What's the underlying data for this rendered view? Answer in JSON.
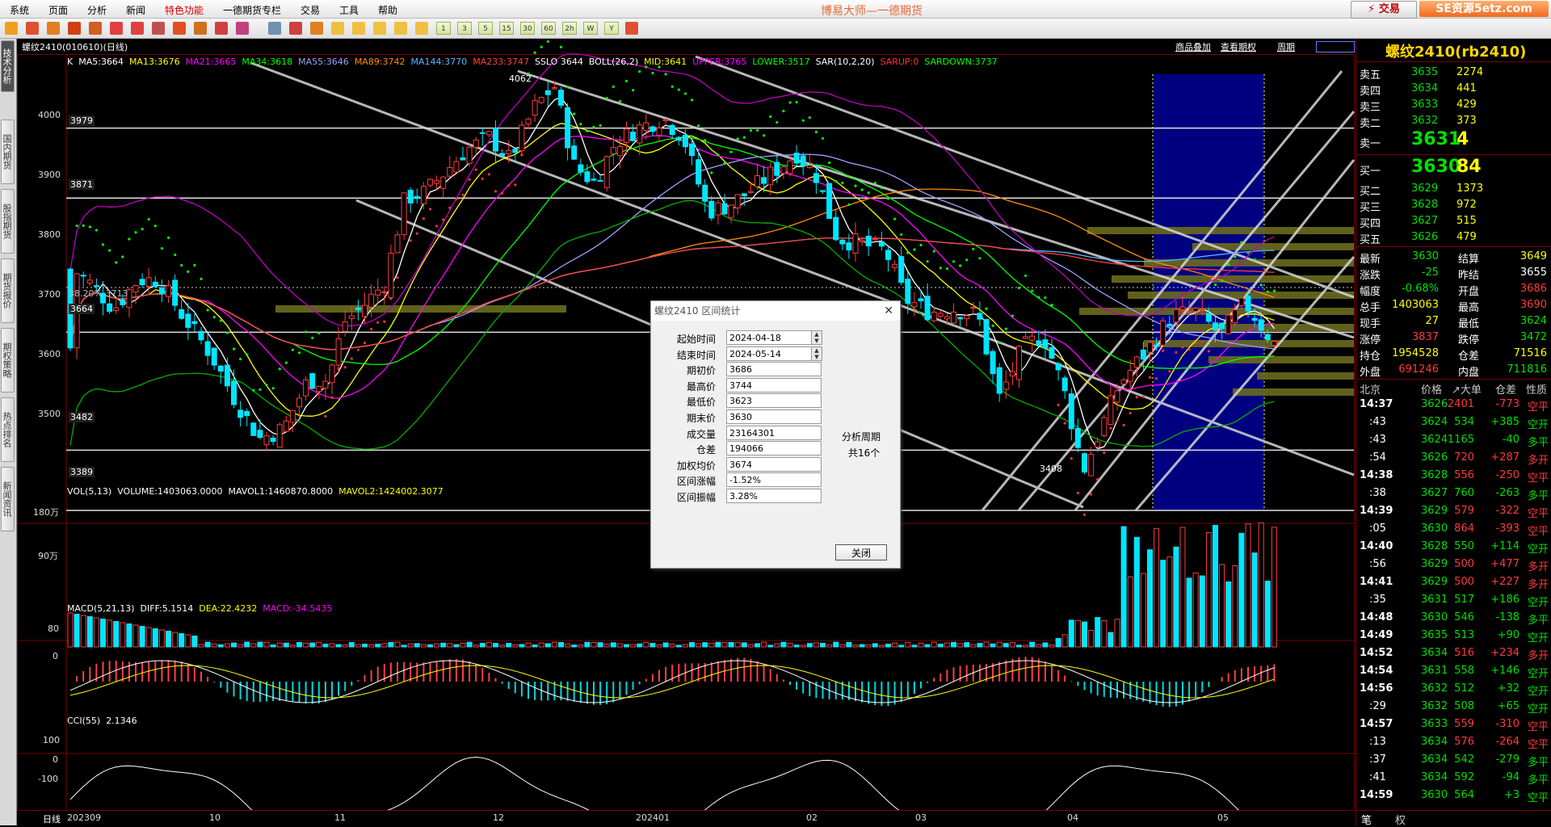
{
  "app_title": "博易大师—一德期货",
  "menu": [
    "系统",
    "页面",
    "分析",
    "新闻",
    "特色功能",
    "一德期货专栏",
    "交易",
    "工具",
    "帮助"
  ],
  "buttons": {
    "trade": "交易",
    "notice": "SE资源5etz.com"
  },
  "toolbar_periods": [
    "1",
    "3",
    "5",
    "15",
    "30",
    "60",
    "2h",
    "W",
    "Y"
  ],
  "sidebar_tabs": [
    "技术分析",
    "国内期货",
    "股指期货",
    "期货报价",
    "期权策略",
    "热点排名",
    "新闻资讯"
  ],
  "chart": {
    "symbol_label": "螺纹2410(010610)(日线)",
    "top_links": [
      "商品叠加",
      "查看期权",
      "周期"
    ],
    "indicator_line": [
      {
        "t": "K",
        "c": "#ffffff"
      },
      {
        "t": "MA5:3664",
        "c": "#ffffff"
      },
      {
        "t": "MA13:3676",
        "c": "#ffff00"
      },
      {
        "t": "MA21:3665",
        "c": "#ff00ff"
      },
      {
        "t": "MA34:3618",
        "c": "#00ff00"
      },
      {
        "t": "MA55:3646",
        "c": "#9fa0ff"
      },
      {
        "t": "MA89:3742",
        "c": "#ff8c00"
      },
      {
        "t": "MA144:3770",
        "c": "#5ab4ff"
      },
      {
        "t": "MA233:3747",
        "c": "#ff4040"
      },
      {
        "t": "SSLO 3644",
        "c": "#ffffff"
      },
      {
        "t": "BOLL(26,2)",
        "c": "#ffffff"
      },
      {
        "t": "MID:3641",
        "c": "#ffff00"
      },
      {
        "t": "UPPER:3765",
        "c": "#ff00ff"
      },
      {
        "t": "LOWER:3517",
        "c": "#00ff00"
      },
      {
        "t": "SAR(10,2,20)",
        "c": "#ffffff"
      },
      {
        "t": "SARUP:0",
        "c": "#ff3030"
      },
      {
        "t": "SARDOWN:3737",
        "c": "#00ff00"
      }
    ],
    "price_levels": [
      "4000",
      "3900",
      "3800",
      "3700",
      "3600",
      "3500"
    ],
    "hline_labels": [
      "3979",
      "3871",
      "3664",
      "3482",
      "3389"
    ],
    "fib_label": "38.20%",
    "fib_value": "3713",
    "high_marker": "4062",
    "low_marker": "3408",
    "vol_header": [
      {
        "t": "VOL(5,13)",
        "c": "#ffffff"
      },
      {
        "t": "VOLUME:1403063.0000",
        "c": "#ffffff"
      },
      {
        "t": "MAVOL1:1460870.8000",
        "c": "#ffffff"
      },
      {
        "t": "MAVOL2:1424002.3077",
        "c": "#ffff00"
      }
    ],
    "vol_levels": [
      "180万",
      "90万"
    ],
    "macd_header": [
      {
        "t": "MACD(5,21,13)",
        "c": "#ffffff"
      },
      {
        "t": "DIFF:5.1514",
        "c": "#ffffff"
      },
      {
        "t": "DEA:22.4232",
        "c": "#ffff00"
      },
      {
        "t": "MACD:-34.5435",
        "c": "#ff00ff"
      }
    ],
    "macd_levels": [
      "80",
      "0"
    ],
    "cci_header": [
      {
        "t": "CCI(55)",
        "c": "#ffffff"
      },
      {
        "t": "2.1346",
        "c": "#ffffff"
      }
    ],
    "cci_levels": [
      "100",
      "0",
      "-100"
    ],
    "x_labels": [
      "202309",
      "10",
      "11",
      "12",
      "202401",
      "02",
      "03",
      "04",
      "05"
    ],
    "period_tab": "日线"
  },
  "dialog": {
    "title": "螺纹2410 区间统计",
    "fields": [
      {
        "label": "起始时间",
        "value": "2024-04-18"
      },
      {
        "label": "结束时间",
        "value": "2024-05-14"
      },
      {
        "label": "期初价",
        "value": "3686"
      },
      {
        "label": "最高价",
        "value": "3744"
      },
      {
        "label": "最低价",
        "value": "3623"
      },
      {
        "label": "期末价",
        "value": "3630"
      },
      {
        "label": "成交量",
        "value": "23164301"
      },
      {
        "label": "仓差",
        "value": "194066"
      },
      {
        "label": "加权均价",
        "value": "3674"
      },
      {
        "label": "区间涨幅",
        "value": "-1.52%"
      },
      {
        "label": "区间振幅",
        "value": "3.28%"
      }
    ],
    "period_label": "分析周期",
    "period_count": "共16个",
    "close": "关闭"
  },
  "quote": {
    "title": "螺纹2410(rb2410)",
    "asks": [
      {
        "n": "卖五",
        "p": "3635",
        "v": "2274"
      },
      {
        "n": "卖四",
        "p": "3634",
        "v": "441"
      },
      {
        "n": "卖三",
        "p": "3633",
        "v": "429"
      },
      {
        "n": "卖二",
        "p": "3632",
        "v": "373"
      },
      {
        "n": "卖一",
        "p": "3631",
        "v": "4"
      }
    ],
    "bids": [
      {
        "n": "买一",
        "p": "3630",
        "v": "84"
      },
      {
        "n": "买二",
        "p": "3629",
        "v": "1373"
      },
      {
        "n": "买三",
        "p": "3628",
        "v": "972"
      },
      {
        "n": "买四",
        "p": "3627",
        "v": "515"
      },
      {
        "n": "买五",
        "p": "3626",
        "v": "479"
      }
    ],
    "stats": [
      {
        "l1": "最新",
        "v1": "3630",
        "c1": "grn",
        "l2": "结算",
        "v2": "3649",
        "c2": "yel"
      },
      {
        "l1": "涨跌",
        "v1": "-25",
        "c1": "grn",
        "l2": "昨结",
        "v2": "3655",
        "c2": "wht"
      },
      {
        "l1": "幅度",
        "v1": "-0.68%",
        "c1": "grn",
        "l2": "开盘",
        "v2": "3686",
        "c2": "red"
      },
      {
        "l1": "总手",
        "v1": "1403063",
        "c1": "yel",
        "l2": "最高",
        "v2": "3690",
        "c2": "red"
      },
      {
        "l1": "现手",
        "v1": "27",
        "c1": "yel",
        "l2": "最低",
        "v2": "3624",
        "c2": "grn"
      },
      {
        "l1": "涨停",
        "v1": "3837",
        "c1": "red",
        "l2": "跌停",
        "v2": "3472",
        "c2": "grn"
      },
      {
        "l1": "持仓",
        "v1": "1954528",
        "c1": "yel",
        "l2": "仓差",
        "v2": "71516",
        "c2": "yel"
      },
      {
        "l1": "外盘",
        "v1": "691246",
        "c1": "red",
        "l2": "内盘",
        "v2": "711816",
        "c2": "grn"
      }
    ],
    "tick_header": {
      "place": "北京",
      "price": "价格",
      "vol": "↗大单",
      "diff": "仓差",
      "nature": "性质"
    },
    "ticks": [
      {
        "t": "14:37",
        "p": "3626",
        "v": "2401",
        "d": "-773",
        "n": "空平",
        "pc": "grn",
        "vc": "red",
        "nc": "red"
      },
      {
        "t": ":43",
        "p": "3624",
        "v": "534",
        "d": "+385",
        "n": "空开",
        "pc": "grn",
        "vc": "grn",
        "nc": "grn"
      },
      {
        "t": ":43",
        "p": "3624",
        "v": "1165",
        "d": "-40",
        "n": "多平",
        "pc": "grn",
        "vc": "grn",
        "nc": "grn"
      },
      {
        "t": ":54",
        "p": "3626",
        "v": "720",
        "d": "+287",
        "n": "多开",
        "pc": "grn",
        "vc": "red",
        "nc": "red"
      },
      {
        "t": "14:38",
        "p": "3628",
        "v": "556",
        "d": "-250",
        "n": "空平",
        "pc": "grn",
        "vc": "red",
        "nc": "red"
      },
      {
        "t": ":38",
        "p": "3627",
        "v": "760",
        "d": "-263",
        "n": "多平",
        "pc": "grn",
        "vc": "grn",
        "nc": "grn"
      },
      {
        "t": "14:39",
        "p": "3629",
        "v": "579",
        "d": "-322",
        "n": "空平",
        "pc": "grn",
        "vc": "red",
        "nc": "red"
      },
      {
        "t": ":05",
        "p": "3630",
        "v": "864",
        "d": "-393",
        "n": "空平",
        "pc": "grn",
        "vc": "red",
        "nc": "red"
      },
      {
        "t": "14:40",
        "p": "3628",
        "v": "550",
        "d": "+114",
        "n": "空开",
        "pc": "grn",
        "vc": "grn",
        "nc": "grn"
      },
      {
        "t": ":56",
        "p": "3629",
        "v": "500",
        "d": "+477",
        "n": "多开",
        "pc": "grn",
        "vc": "red",
        "nc": "red"
      },
      {
        "t": "14:41",
        "p": "3629",
        "v": "500",
        "d": "+227",
        "n": "多开",
        "pc": "grn",
        "vc": "red",
        "nc": "red"
      },
      {
        "t": ":35",
        "p": "3631",
        "v": "517",
        "d": "+186",
        "n": "空开",
        "pc": "grn",
        "vc": "grn",
        "nc": "grn"
      },
      {
        "t": "14:48",
        "p": "3630",
        "v": "546",
        "d": "-138",
        "n": "多平",
        "pc": "grn",
        "vc": "grn",
        "nc": "grn"
      },
      {
        "t": "14:49",
        "p": "3635",
        "v": "513",
        "d": "+90",
        "n": "空开",
        "pc": "grn",
        "vc": "grn",
        "nc": "grn"
      },
      {
        "t": "14:52",
        "p": "3634",
        "v": "516",
        "d": "+234",
        "n": "多开",
        "pc": "grn",
        "vc": "red",
        "nc": "red"
      },
      {
        "t": "14:54",
        "p": "3631",
        "v": "558",
        "d": "+146",
        "n": "空开",
        "pc": "grn",
        "vc": "grn",
        "nc": "grn"
      },
      {
        "t": "14:56",
        "p": "3632",
        "v": "512",
        "d": "+32",
        "n": "空开",
        "pc": "grn",
        "vc": "grn",
        "nc": "grn"
      },
      {
        "t": ":29",
        "p": "3632",
        "v": "508",
        "d": "+65",
        "n": "空开",
        "pc": "grn",
        "vc": "grn",
        "nc": "grn"
      },
      {
        "t": "14:57",
        "p": "3633",
        "v": "559",
        "d": "-310",
        "n": "空平",
        "pc": "grn",
        "vc": "red",
        "nc": "red"
      },
      {
        "t": ":13",
        "p": "3634",
        "v": "576",
        "d": "-264",
        "n": "空平",
        "pc": "grn",
        "vc": "red",
        "nc": "red"
      },
      {
        "t": ":37",
        "p": "3634",
        "v": "542",
        "d": "-279",
        "n": "多平",
        "pc": "grn",
        "vc": "grn",
        "nc": "grn"
      },
      {
        "t": ":41",
        "p": "3634",
        "v": "592",
        "d": "-94",
        "n": "多平",
        "pc": "grn",
        "vc": "grn",
        "nc": "grn"
      },
      {
        "t": "14:59",
        "p": "3630",
        "v": "564",
        "d": "+3",
        "n": "空平",
        "pc": "grn",
        "vc": "grn",
        "nc": "grn"
      }
    ],
    "bottom_tabs": [
      "笔",
      "权"
    ]
  },
  "chart_data": {
    "type": "candlestick",
    "title": "螺纹2410(010610)(日线)",
    "y_range": [
      3389,
      4062
    ],
    "x_months": [
      "202309",
      "10",
      "11",
      "12",
      "202401",
      "02",
      "03",
      "04",
      "05"
    ],
    "key_levels": [
      3979,
      3871,
      3664,
      3482,
      3389
    ],
    "high": 4062,
    "low": 3408,
    "last": 3630,
    "analysis_window": {
      "start": "2024-04-18",
      "end": "2024-05-14",
      "periods": 16
    }
  },
  "colors": {
    "up": "#ff3b3b",
    "down": "#00e5ff",
    "ma5": "#ffffff",
    "ma13": "#ffff00",
    "ma21": "#ff00ff",
    "ma34": "#00ff00",
    "window": "#000080"
  }
}
